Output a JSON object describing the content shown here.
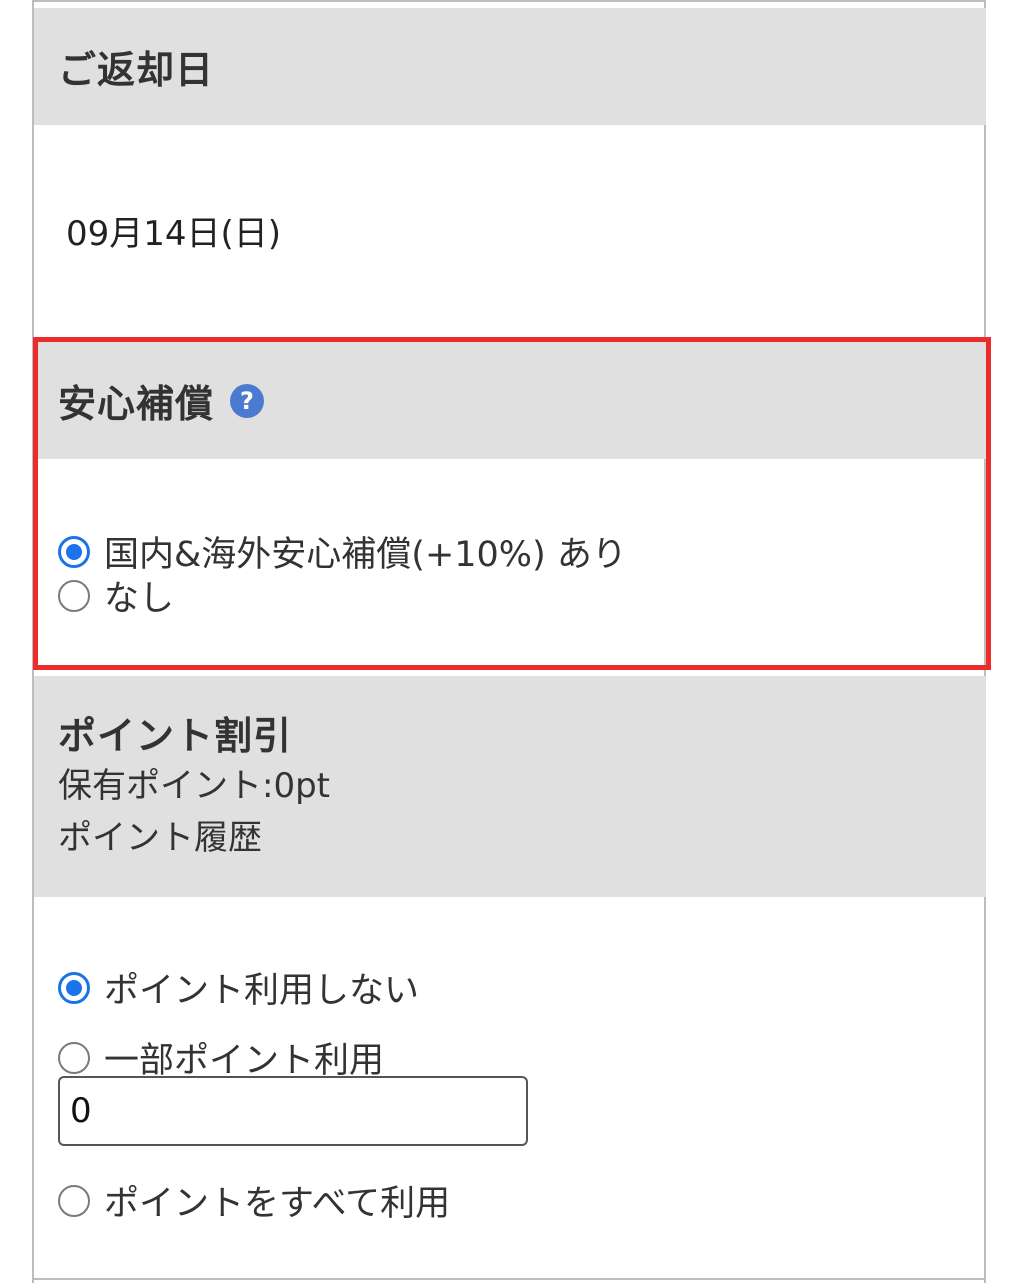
{
  "return_date": {
    "title": "ご返却日",
    "value": "09月14日(日)"
  },
  "insurance": {
    "title": "安心補償",
    "help_icon": "?",
    "options": [
      {
        "label": "国内&海外安心補償(+10%) あり",
        "selected": true
      },
      {
        "label": "なし",
        "selected": false
      }
    ]
  },
  "points": {
    "title": "ポイント割引",
    "balance_text": "保有ポイント:0pt",
    "history_link": "ポイント履歴",
    "options": [
      {
        "label": "ポイント利用しない",
        "selected": true
      },
      {
        "label": "一部ポイント利用",
        "selected": false
      },
      {
        "label": "ポイントをすべて利用",
        "selected": false
      }
    ],
    "partial_value": "0"
  },
  "colors": {
    "accent": "#1a73e8",
    "highlight": "#ee2b2b",
    "header_bg": "#e0e0e0"
  }
}
